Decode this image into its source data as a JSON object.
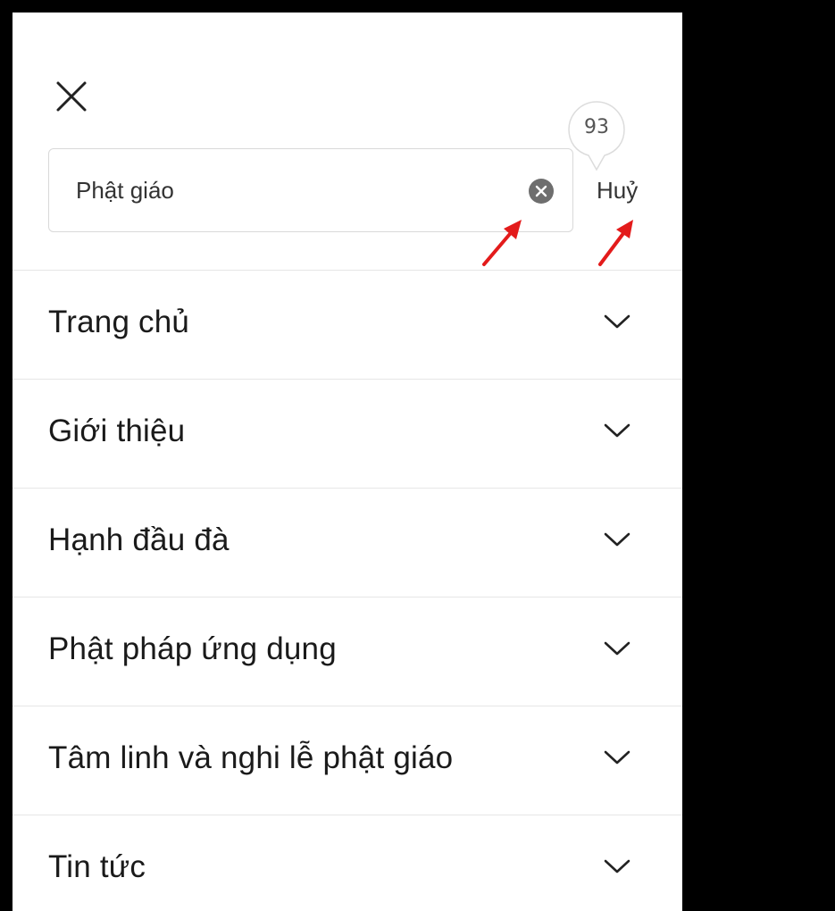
{
  "search": {
    "value": "Phật giáo",
    "cancel_label": "Huỷ",
    "result_count": "93"
  },
  "icons": {
    "close": "close-icon",
    "clear": "clear-circle-icon",
    "chevron": "chevron-down-icon"
  },
  "colors": {
    "panel_bg": "#ffffff",
    "backdrop": "#000000",
    "text": "#1a1a1a",
    "annotation": "#e31b1b",
    "caret": "#e0a300"
  },
  "menu": {
    "items": [
      {
        "label": "Trang chủ"
      },
      {
        "label": "Giới thiệu"
      },
      {
        "label": "Hạnh đầu đà"
      },
      {
        "label": "Phật pháp ứng dụng"
      },
      {
        "label": "Tâm linh và nghi lễ phật giáo"
      },
      {
        "label": "Tin tức"
      }
    ]
  }
}
